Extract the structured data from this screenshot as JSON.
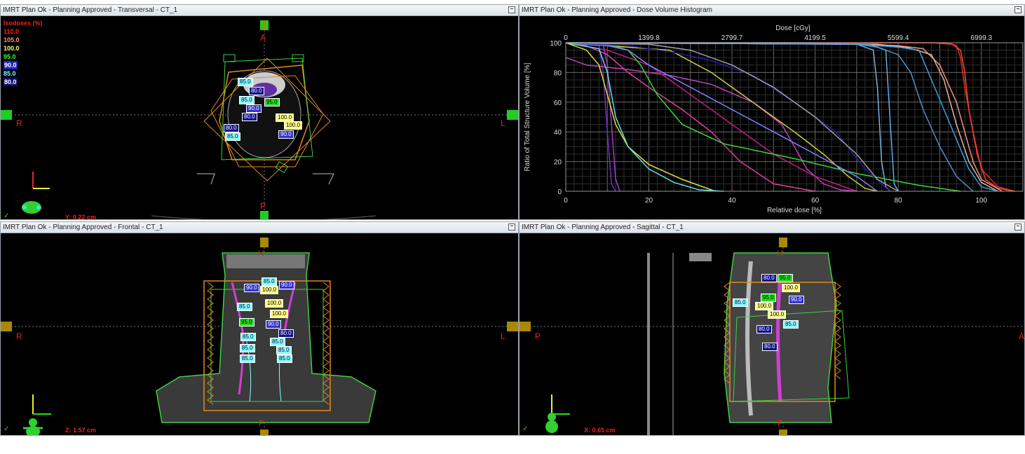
{
  "panels": {
    "transversal": {
      "title": "IMRT Plan Ok  -  Planning Approved - Transversal - CT_1",
      "orient": {
        "top": "A",
        "bottom": "P",
        "left": "R",
        "right": "L"
      },
      "coord": "Y: 0.22 cm",
      "labels": [
        "85.0",
        "80.0",
        "85.0",
        "90.0",
        "95.0",
        "80.0",
        "100.0",
        "100.0",
        "80.0",
        "85.0",
        "90.0"
      ]
    },
    "dvh": {
      "title": "IMRT Plan Ok  -  Planning Approved - Dose Volume Histogram"
    },
    "frontal": {
      "title": "IMRT Plan Ok  -  Planning Approved - Frontal - CT_1",
      "orient": {
        "top": "H",
        "bottom": "F",
        "left": "R",
        "right": "L"
      },
      "coord": "Z: 1.57 cm",
      "labels": [
        "90.0",
        "85.0",
        "90.0",
        "100.0",
        "85.0",
        "100.0",
        "100.0",
        "95.0",
        "90.0",
        "80.0",
        "85.0",
        "85.0",
        "85.0",
        "85.0",
        "85.0",
        "85.0"
      ]
    },
    "sagittal": {
      "title": "IMRT Plan Ok  -  Planning Approved - Sagittal - CT_1",
      "orient": {
        "top": "H",
        "bottom": "F",
        "left": "P",
        "right": "A"
      },
      "coord": "X: 0.65 cm",
      "labels": [
        "80.0",
        "95.0",
        "100.0",
        "85.0",
        "95.0",
        "90.0",
        "100.0",
        "100.0",
        "85.0",
        "80.0",
        "80.0"
      ]
    }
  },
  "isodoses": {
    "title": "Isodoses (%)",
    "levels": [
      {
        "value": "110.0",
        "color": "#ff2020"
      },
      {
        "value": "105.0",
        "color": "#ff9080"
      },
      {
        "value": "100.0",
        "color": "#ffff60"
      },
      {
        "value": "95.0",
        "color": "#30ff30"
      },
      {
        "value": "90.0",
        "color": "#ffffff"
      },
      {
        "value": "85.0",
        "color": "#80ffff"
      },
      {
        "value": "80.0",
        "color": "#ffffff"
      }
    ]
  },
  "chart_data": {
    "type": "line",
    "title": "",
    "xlabel": "Relative dose [%]",
    "ylabel": "Ratio of Total Structure Volume [%]",
    "x2label": "Dose [cGy]",
    "xlim": [
      0,
      110
    ],
    "ylim": [
      0,
      100
    ],
    "xticks": [
      0,
      20,
      40,
      60,
      80,
      100
    ],
    "yticks": [
      0,
      20,
      40,
      60,
      80,
      100
    ],
    "x2ticks": [
      "0",
      "1399.8",
      "2799.7",
      "4199.5",
      "5599.4",
      "6999.3"
    ],
    "grid": true,
    "series": [
      {
        "color": "#e03020",
        "x": [
          0,
          85,
          92,
          94,
          95,
          96,
          98,
          100,
          104,
          108
        ],
        "y": [
          100,
          100,
          100,
          98,
          90,
          70,
          40,
          15,
          3,
          0
        ]
      },
      {
        "color": "#ff4030",
        "x": [
          0,
          88,
          93,
          95,
          96,
          97,
          99,
          101,
          104,
          108
        ],
        "y": [
          100,
          100,
          99,
          95,
          80,
          55,
          25,
          8,
          2,
          0
        ]
      },
      {
        "color": "#f09080",
        "x": [
          0,
          70,
          80,
          86,
          90,
          94,
          96,
          98,
          100,
          105
        ],
        "y": [
          100,
          99,
          98,
          96,
          85,
          60,
          40,
          20,
          8,
          0
        ]
      },
      {
        "color": "#e8b0a0",
        "x": [
          0,
          75,
          82,
          88,
          91,
          94,
          97,
          100,
          104
        ],
        "y": [
          100,
          99,
          97,
          92,
          75,
          45,
          20,
          6,
          0
        ]
      },
      {
        "color": "#3aa0e0",
        "x": [
          0,
          70,
          80,
          85,
          88,
          91,
          94,
          97,
          100,
          104
        ],
        "y": [
          100,
          99,
          97,
          95,
          75,
          55,
          35,
          15,
          3,
          0
        ]
      },
      {
        "color": "#4f8fc8",
        "x": [
          0,
          60,
          70,
          75,
          80,
          83,
          86,
          90,
          94,
          98
        ],
        "y": [
          100,
          100,
          99,
          97,
          92,
          80,
          55,
          30,
          10,
          0
        ]
      },
      {
        "color": "#7fb0e0",
        "x": [
          0,
          70,
          74,
          75,
          76,
          77,
          78
        ],
        "y": [
          100,
          99,
          95,
          70,
          20,
          3,
          0
        ]
      },
      {
        "color": "#60a8e8",
        "x": [
          0,
          73,
          77,
          78,
          79,
          80
        ],
        "y": [
          100,
          99,
          95,
          50,
          5,
          0
        ]
      },
      {
        "color": "#7030c0",
        "x": [
          0,
          8,
          9,
          10,
          11,
          12
        ],
        "y": [
          100,
          98,
          80,
          40,
          5,
          0
        ]
      },
      {
        "color": "#a040c0",
        "x": [
          0,
          9,
          10,
          11,
          12,
          13
        ],
        "y": [
          100,
          99,
          85,
          45,
          8,
          0
        ]
      },
      {
        "color": "#c040c0",
        "x": [
          0,
          5,
          15,
          25,
          35,
          45,
          52,
          55,
          58,
          62,
          66,
          70
        ],
        "y": [
          90,
          85,
          82,
          78,
          72,
          60,
          45,
          30,
          15,
          5,
          1,
          0
        ]
      },
      {
        "color": "#e040a0",
        "x": [
          0,
          5,
          10,
          15,
          20,
          28,
          35,
          42,
          50,
          60
        ],
        "y": [
          100,
          98,
          92,
          80,
          70,
          55,
          40,
          20,
          5,
          0
        ]
      },
      {
        "color": "#c02080",
        "x": [
          0,
          10,
          15,
          20,
          25,
          30,
          40,
          50,
          60,
          70
        ],
        "y": [
          100,
          95,
          90,
          85,
          75,
          65,
          45,
          25,
          10,
          0
        ]
      },
      {
        "color": "#e0e040",
        "x": [
          0,
          5,
          8,
          10,
          12,
          15,
          20,
          28,
          36
        ],
        "y": [
          100,
          95,
          85,
          65,
          45,
          30,
          18,
          8,
          0
        ]
      },
      {
        "color": "#d0d040",
        "x": [
          0,
          25,
          35,
          45,
          55,
          62,
          68,
          72,
          75
        ],
        "y": [
          100,
          95,
          80,
          60,
          40,
          25,
          10,
          2,
          0
        ]
      },
      {
        "color": "#40d040",
        "x": [
          0,
          10,
          15,
          18,
          22,
          28,
          38,
          55,
          70,
          85,
          95
        ],
        "y": [
          100,
          99,
          95,
          85,
          65,
          45,
          32,
          22,
          12,
          4,
          0
        ]
      },
      {
        "color": "#8080ff",
        "x": [
          0,
          10,
          15,
          20,
          30,
          40,
          50,
          60,
          70,
          75
        ],
        "y": [
          100,
          98,
          95,
          85,
          70,
          55,
          40,
          25,
          10,
          0
        ]
      },
      {
        "color": "#2020a0",
        "x": [
          0,
          15,
          25,
          35,
          45,
          55,
          65,
          72,
          78
        ],
        "y": [
          100,
          98,
          94,
          88,
          78,
          60,
          40,
          15,
          0
        ]
      },
      {
        "color": "#60e0e0",
        "x": [
          0,
          8,
          10,
          12,
          15,
          20,
          26,
          32,
          38
        ],
        "y": [
          100,
          96,
          80,
          50,
          30,
          15,
          6,
          1,
          0
        ]
      },
      {
        "color": "#a0a0a0",
        "x": [
          0,
          20,
          30,
          40,
          50,
          60,
          70,
          75,
          80
        ],
        "y": [
          100,
          99,
          95,
          85,
          70,
          50,
          25,
          8,
          0
        ]
      }
    ]
  }
}
